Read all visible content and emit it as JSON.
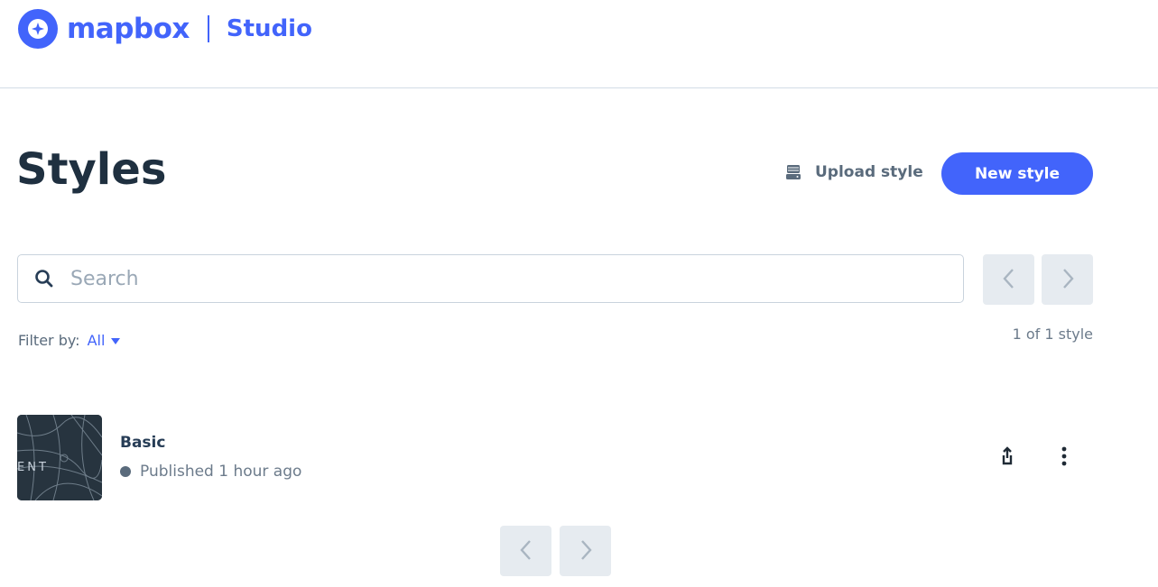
{
  "header": {
    "brand": "mapbox",
    "product": "Studio"
  },
  "page": {
    "title": "Styles"
  },
  "actions": {
    "upload_label": "Upload style",
    "new_style_label": "New style"
  },
  "search": {
    "placeholder": "Search",
    "value": ""
  },
  "filter": {
    "label": "Filter by:",
    "value": "All"
  },
  "count_text": "1 of 1 style",
  "styles": [
    {
      "name": "Basic",
      "status": "Published 1 hour ago",
      "thumb_text": "ENT"
    }
  ],
  "colors": {
    "brand_blue": "#4264fb",
    "pager_bg": "#e6ebf0",
    "status_dot": "#5a6b7c"
  },
  "icons": {
    "logo": "mapbox-logo-icon",
    "upload": "upload-drive-icon",
    "search": "search-icon",
    "prev": "chevron-left-icon",
    "next": "chevron-right-icon",
    "filter_caret": "caret-down-icon",
    "share": "share-icon",
    "more": "more-vertical-icon"
  }
}
